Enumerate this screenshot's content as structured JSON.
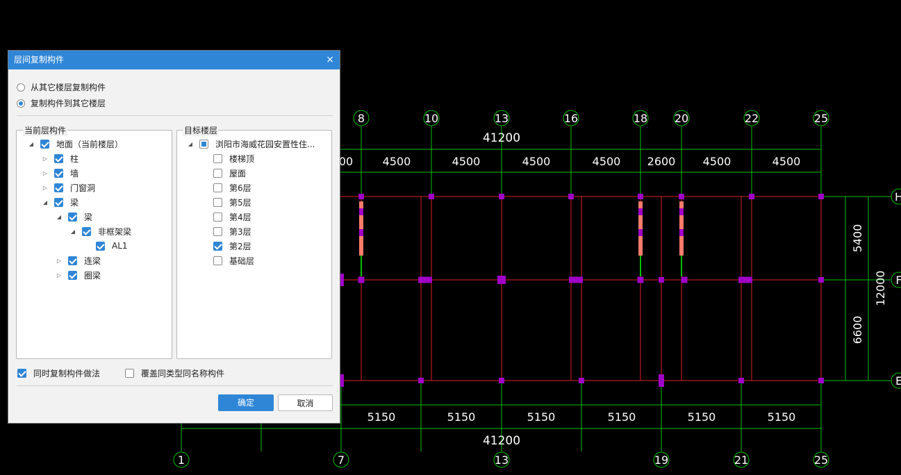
{
  "dialog": {
    "title": "层间复制构件",
    "close": "×",
    "radio_from": "从其它楼层复制构件",
    "radio_to": "复制构件到其它楼层",
    "source_group": "当前层构件",
    "target_group": "目标楼层",
    "source_tree": [
      {
        "label": "地面（当前楼层）",
        "level": 0,
        "toggle": "expanded",
        "state": "on"
      },
      {
        "label": "柱",
        "level": 1,
        "toggle": "collapsed",
        "state": "on"
      },
      {
        "label": "墙",
        "level": 1,
        "toggle": "collapsed",
        "state": "on"
      },
      {
        "label": "门窗洞",
        "level": 1,
        "toggle": "collapsed",
        "state": "on"
      },
      {
        "label": "梁",
        "level": 1,
        "toggle": "expanded",
        "state": "on"
      },
      {
        "label": "梁",
        "level": 2,
        "toggle": "expanded",
        "state": "on"
      },
      {
        "label": "非框架梁",
        "level": 3,
        "toggle": "expanded",
        "state": "on"
      },
      {
        "label": "AL1",
        "level": 4,
        "toggle": "none",
        "state": "on"
      },
      {
        "label": "连梁",
        "level": 2,
        "toggle": "collapsed",
        "state": "on"
      },
      {
        "label": "圈梁",
        "level": 2,
        "toggle": "collapsed",
        "state": "on"
      }
    ],
    "target_tree": [
      {
        "label": "浏阳市海威花园安置性住...",
        "level": 0,
        "toggle": "expanded",
        "state": "part"
      },
      {
        "label": "楼梯顶",
        "level": 1,
        "toggle": "none",
        "state": "off"
      },
      {
        "label": "屋面",
        "level": 1,
        "toggle": "none",
        "state": "off"
      },
      {
        "label": "第6层",
        "level": 1,
        "toggle": "none",
        "state": "off"
      },
      {
        "label": "第5层",
        "level": 1,
        "toggle": "none",
        "state": "off"
      },
      {
        "label": "第4层",
        "level": 1,
        "toggle": "none",
        "state": "off"
      },
      {
        "label": "第3层",
        "level": 1,
        "toggle": "none",
        "state": "off"
      },
      {
        "label": "第2层",
        "level": 1,
        "toggle": "none",
        "state": "on"
      },
      {
        "label": "基础层",
        "level": 1,
        "toggle": "none",
        "state": "off"
      }
    ],
    "option_copy_method": "同时复制构件做法",
    "option_overwrite": "覆盖同类型同名称构件",
    "ok": "确定",
    "cancel": "取消"
  },
  "cad": {
    "colors": {
      "grid": "#00c000",
      "beam": "#e02020",
      "column": "#a000c8",
      "stair": "#ff7b6b",
      "text": "#ffffff"
    },
    "top_axes": [
      "8",
      "10",
      "13",
      "16",
      "18",
      "20",
      "22",
      "25"
    ],
    "bottom_axes": [
      "1",
      "7",
      "13",
      "19",
      "21",
      "25"
    ],
    "right_axes": [
      "H",
      "F",
      "E"
    ],
    "top_total": "41200",
    "top_segments": [
      "00",
      "4500",
      "4500",
      "4500",
      "4500",
      "2600",
      "4500",
      "4500"
    ],
    "bottom_total": "41200",
    "bottom_segments": [
      "5150",
      "5150",
      "5150",
      "5150",
      "5150",
      "5150"
    ],
    "right_segments": [
      "5400",
      "6600"
    ],
    "right_total": "12000"
  }
}
